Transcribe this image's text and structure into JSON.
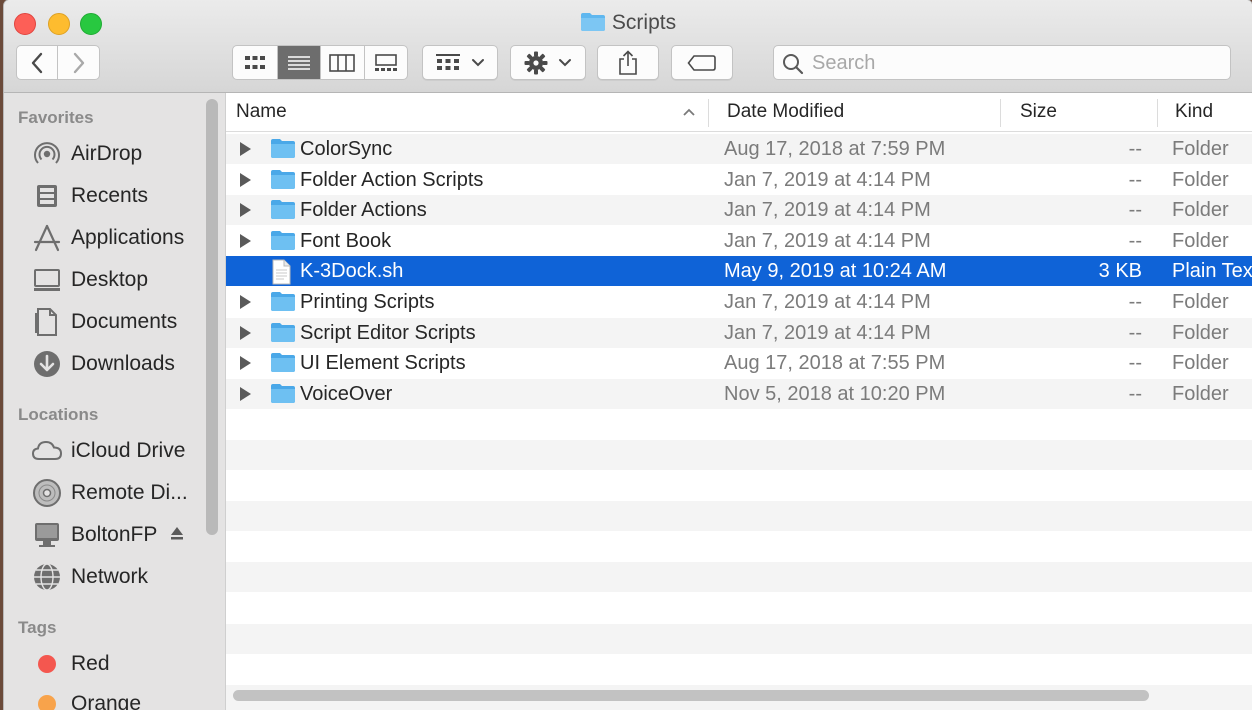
{
  "window": {
    "title": "Scripts"
  },
  "toolbar": {
    "search_placeholder": "Search",
    "icons": [
      "chevron-left-icon",
      "chevron-right-icon",
      "icon-view-icon",
      "list-view-icon",
      "column-view-icon",
      "gallery-view-icon",
      "group-icon",
      "gear-icon",
      "share-icon",
      "tag-icon"
    ]
  },
  "sidebar": {
    "favorites_label": "Favorites",
    "favorites": [
      {
        "label": "AirDrop",
        "icon": "airdrop-icon"
      },
      {
        "label": "Recents",
        "icon": "recents-icon"
      },
      {
        "label": "Applications",
        "icon": "applications-icon"
      },
      {
        "label": "Desktop",
        "icon": "desktop-icon"
      },
      {
        "label": "Documents",
        "icon": "documents-icon"
      },
      {
        "label": "Downloads",
        "icon": "downloads-icon"
      }
    ],
    "locations_label": "Locations",
    "locations": [
      {
        "label": "iCloud Drive",
        "icon": "cloud-icon"
      },
      {
        "label": "Remote Di...",
        "icon": "disc-icon"
      },
      {
        "label": "BoltonFP",
        "icon": "computer-icon"
      },
      {
        "label": "Network",
        "icon": "network-icon"
      }
    ],
    "tags_label": "Tags",
    "tags": [
      {
        "label": "Red",
        "color": "#f4574f"
      },
      {
        "label": "Orange",
        "color": "#f8a34b"
      }
    ]
  },
  "columns": {
    "name": "Name",
    "date": "Date Modified",
    "size": "Size",
    "kind": "Kind"
  },
  "files": [
    {
      "name": "ColorSync",
      "date": "Aug 17, 2018 at 7:59 PM",
      "size": "--",
      "kind": "Folder",
      "type": "folder"
    },
    {
      "name": "Folder Action Scripts",
      "date": "Jan 7, 2019 at 4:14 PM",
      "size": "--",
      "kind": "Folder",
      "type": "folder"
    },
    {
      "name": "Folder Actions",
      "date": "Jan 7, 2019 at 4:14 PM",
      "size": "--",
      "kind": "Folder",
      "type": "folder"
    },
    {
      "name": "Font Book",
      "date": "Jan 7, 2019 at 4:14 PM",
      "size": "--",
      "kind": "Folder",
      "type": "folder"
    },
    {
      "name": "K-3Dock.sh",
      "date": "May 9, 2019 at 10:24 AM",
      "size": "3 KB",
      "kind": "Plain Text",
      "type": "file",
      "selected": true
    },
    {
      "name": "Printing Scripts",
      "date": "Jan 7, 2019 at 4:14 PM",
      "size": "--",
      "kind": "Folder",
      "type": "folder"
    },
    {
      "name": "Script Editor Scripts",
      "date": "Jan 7, 2019 at 4:14 PM",
      "size": "--",
      "kind": "Folder",
      "type": "folder"
    },
    {
      "name": "UI Element Scripts",
      "date": "Aug 17, 2018 at 7:55 PM",
      "size": "--",
      "kind": "Folder",
      "type": "folder"
    },
    {
      "name": "VoiceOver",
      "date": "Nov 5, 2018 at 10:20 PM",
      "size": "--",
      "kind": "Folder",
      "type": "folder"
    }
  ],
  "colors": {
    "selection": "#0f63d7",
    "folder": "#5fb7ef",
    "sidebar_bg": "#e4e3e3"
  }
}
